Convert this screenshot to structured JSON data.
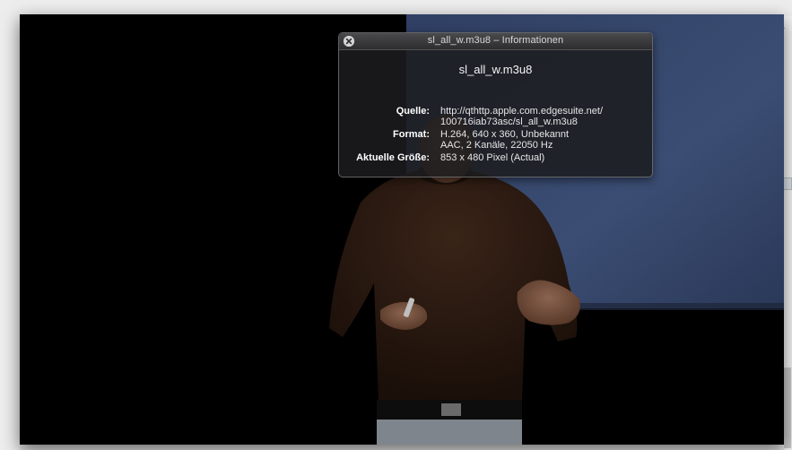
{
  "hud": {
    "title": "sl_all_w.m3u8 – Informationen",
    "filename": "sl_all_w.m3u8",
    "rows": [
      {
        "label": "Quelle:",
        "lines": [
          "http://qthttp.apple.com.edgesuite.net/",
          "100716iab73asc/sl_all_w.m3u8"
        ]
      },
      {
        "label": "Format:",
        "lines": [
          "H.264, 640 x 360, Unbekannt",
          "AAC, 2 Kanäle, 22050 Hz"
        ]
      },
      {
        "label": "Aktuelle Größe:",
        "lines": [
          "853 x 480 Pixel (Actual)"
        ]
      }
    ]
  },
  "background_window": {
    "edge_text": "r"
  },
  "colors": {
    "video_background": "#000000",
    "screen_blue": "#34456a",
    "hud_background": "#1c1c1e"
  },
  "icons": {
    "close": "close-icon"
  }
}
